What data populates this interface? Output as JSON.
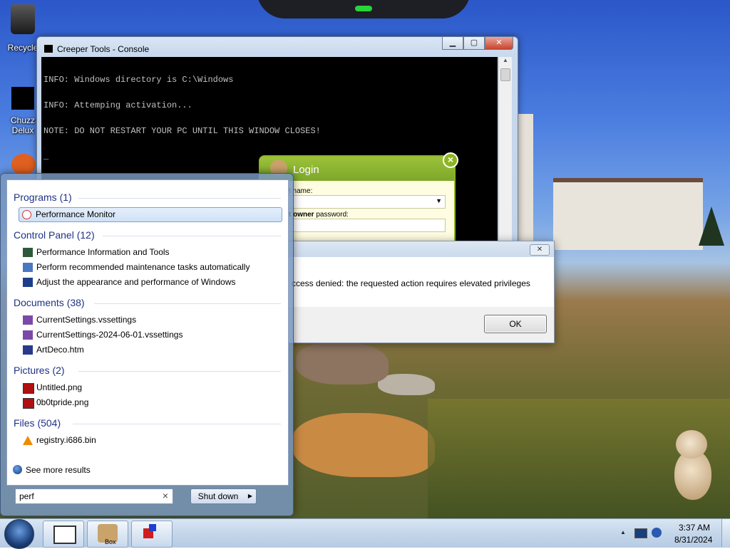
{
  "desktop": {
    "icons": [
      {
        "label": "Recycle"
      },
      {
        "label": "Chuzz\nDelux"
      }
    ]
  },
  "console_window": {
    "title": "Creeper Tools - Console",
    "lines": [
      "INFO: Windows directory is C:\\Windows",
      "INFO: Attemping activation...",
      "NOTE: DO NOT RESTART YOUR PC UNTIL THIS WINDOW CLOSES!"
    ],
    "cursor": "_"
  },
  "login_panel": {
    "title": "Login",
    "account_label": "t name:",
    "owner_label_bold": "t owner",
    "owner_label_rest": " password:",
    "close_glyph": "×"
  },
  "error_dialog": {
    "message": "ccess denied: the requested action requires elevated privileges",
    "ok_label": "OK",
    "close_glyph": "✕"
  },
  "start_menu": {
    "categories": [
      {
        "label": "Programs (1)",
        "items": [
          "Performance Monitor"
        ]
      },
      {
        "label": "Control Panel (12)",
        "items": [
          "Performance Information and Tools",
          "Perform recommended maintenance tasks automatically",
          "Adjust the appearance and performance of Windows"
        ]
      },
      {
        "label": "Documents (38)",
        "items": [
          "CurrentSettings.vssettings",
          "CurrentSettings-2024-06-01.vssettings",
          "ArtDeco.htm"
        ]
      },
      {
        "label": "Pictures (2)",
        "items": [
          "Untitled.png",
          "0b0tpride.png"
        ]
      },
      {
        "label": "Files (504)",
        "items": [
          "registry.i686.bin"
        ]
      }
    ],
    "see_more": "See more results",
    "search_value": "perf",
    "search_clear": "×",
    "shutdown_label": "Shut down",
    "shutdown_arrow": "▶"
  },
  "taskbar": {
    "buttons": [
      {
        "label": ""
      },
      {
        "label": "Box"
      },
      {
        "label": ""
      }
    ],
    "clock_time": "3:37 AM",
    "clock_date": "8/31/2024",
    "tray_arrow": "▲"
  },
  "colors": {
    "login_green": "#8db521",
    "category_blue": "#1e3287",
    "console_bg": "#000000"
  }
}
